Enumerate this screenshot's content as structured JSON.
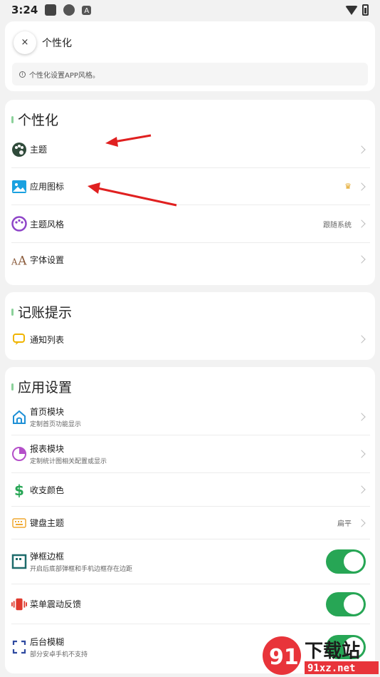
{
  "status_bar": {
    "time": "3:24"
  },
  "header": {
    "close_symbol": "×",
    "title": "个性化",
    "info_text": "个性化设置APP风格。"
  },
  "sections": {
    "personalize": {
      "title": "个性化",
      "rows": [
        {
          "label": "主题"
        },
        {
          "label": "应用图标"
        },
        {
          "label": "主题风格",
          "value": "跟随系统"
        },
        {
          "label": "字体设置"
        }
      ]
    },
    "reminder": {
      "title": "记账提示",
      "rows": [
        {
          "label": "通知列表"
        }
      ]
    },
    "app_settings": {
      "title": "应用设置",
      "rows": [
        {
          "label": "首页模块",
          "sub": "定制首页功能显示"
        },
        {
          "label": "报表模块",
          "sub": "定制统计图相关配置或显示"
        },
        {
          "label": "收支颜色"
        },
        {
          "label": "键盘主题",
          "value": "扁平"
        },
        {
          "label": "弹框边框",
          "sub": "开启后底部弹框和手机边框存在边距",
          "toggle": true
        },
        {
          "label": "菜单震动反馈",
          "toggle": true
        },
        {
          "label": "后台模糊",
          "sub": "部分安卓手机不支持",
          "toggle": true
        }
      ]
    }
  },
  "icons": {
    "theme": "palette-icon",
    "app_icon": "image-icon",
    "theme_style": "palette-outline-icon",
    "font": "font-aa-icon",
    "notification": "message-icon",
    "home": "home-icon",
    "report": "pie-chart-icon",
    "color": "dollar-icon",
    "keyboard": "keyboard-icon",
    "border": "frame-icon",
    "vibration": "vibration-icon",
    "blur": "blur-frame-icon",
    "premium": "crown-icon"
  },
  "colors": {
    "toggle_on": "#27a655",
    "section_accent": "#8bd19a",
    "annotation_arrow": "#e02020"
  },
  "watermark": {
    "brand": "下载站",
    "domain": "91xz.net"
  }
}
